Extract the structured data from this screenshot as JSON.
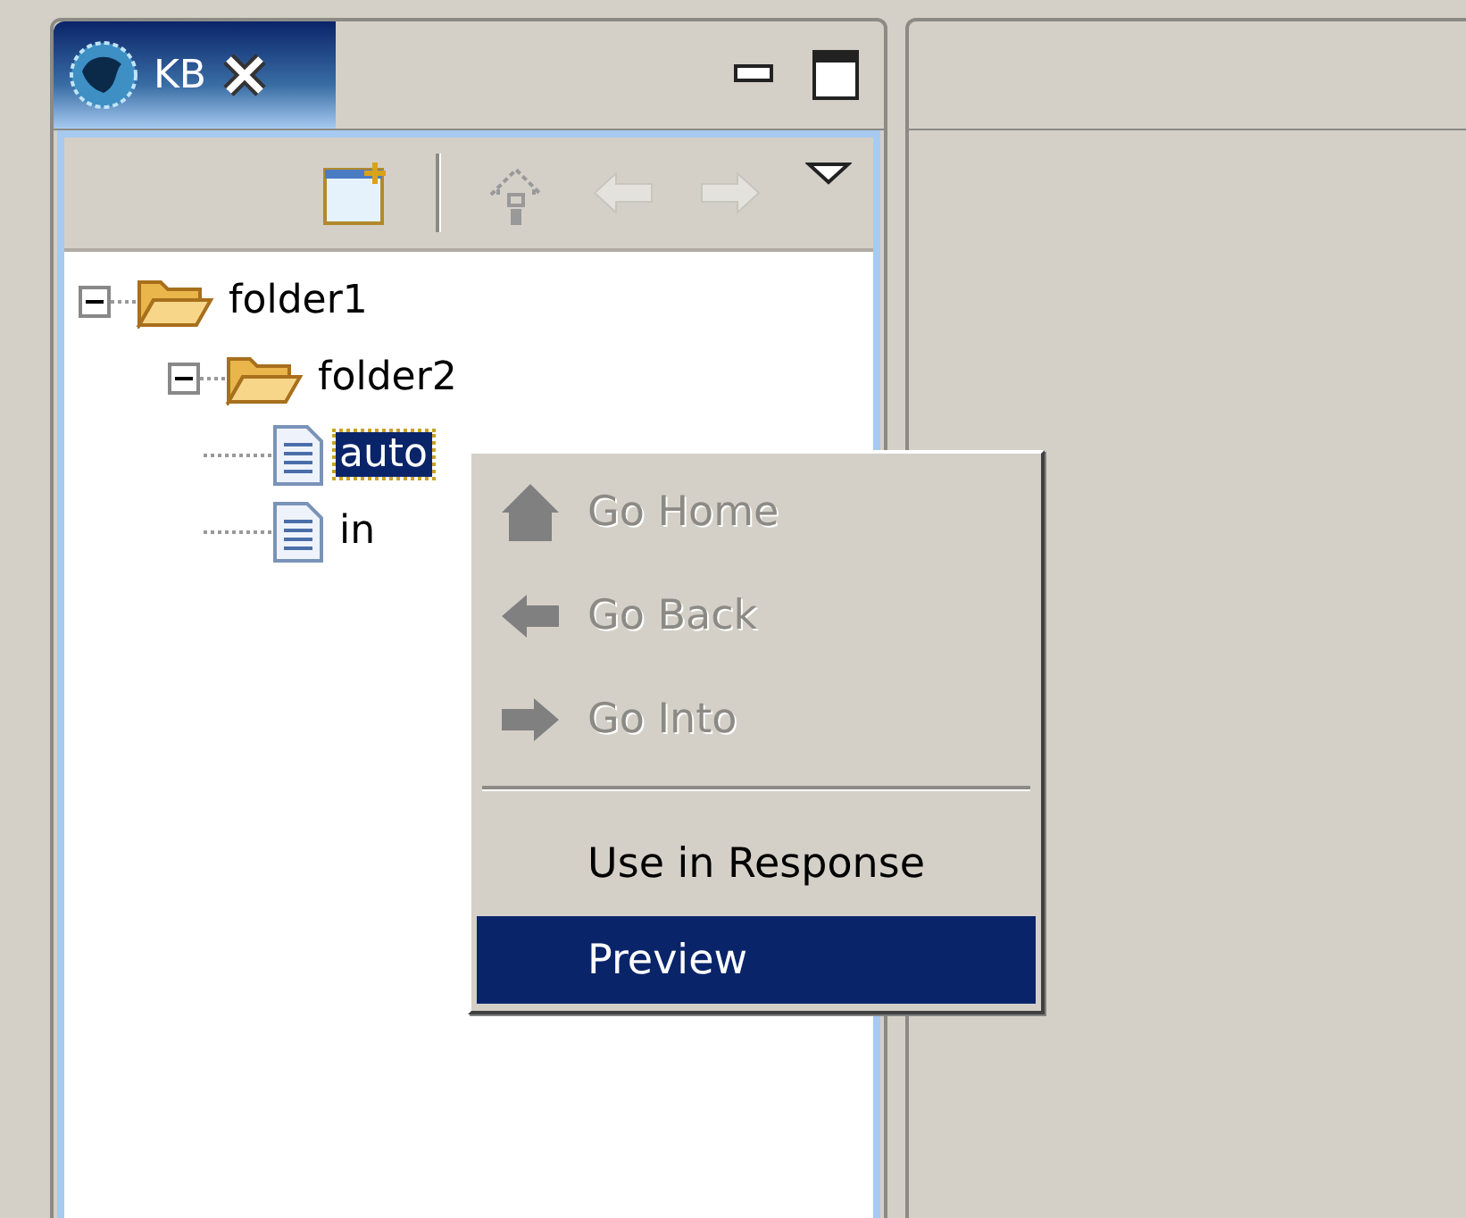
{
  "view": {
    "tab": {
      "label": "KB",
      "selected": true
    }
  },
  "tree": [
    {
      "kind": "folder",
      "label": "folder1",
      "expanded": true,
      "selected": false,
      "children": [
        {
          "kind": "folder",
          "label": "folder2",
          "expanded": true,
          "selected": false,
          "children": [
            {
              "kind": "file",
              "label": "auto",
              "selected": true
            },
            {
              "kind": "file",
              "label": "in",
              "selected": false
            }
          ]
        }
      ]
    }
  ],
  "context_menu": [
    {
      "kind": "item",
      "label": "Go Home",
      "disabled": true,
      "selected": false
    },
    {
      "kind": "item",
      "label": "Go Back",
      "disabled": true,
      "selected": false
    },
    {
      "kind": "item",
      "label": "Go Into",
      "disabled": true,
      "selected": false
    },
    {
      "kind": "separator"
    },
    {
      "kind": "item",
      "label": "Use in Response",
      "disabled": false,
      "selected": false
    },
    {
      "kind": "item",
      "label": "Preview",
      "disabled": false,
      "selected": true
    }
  ]
}
